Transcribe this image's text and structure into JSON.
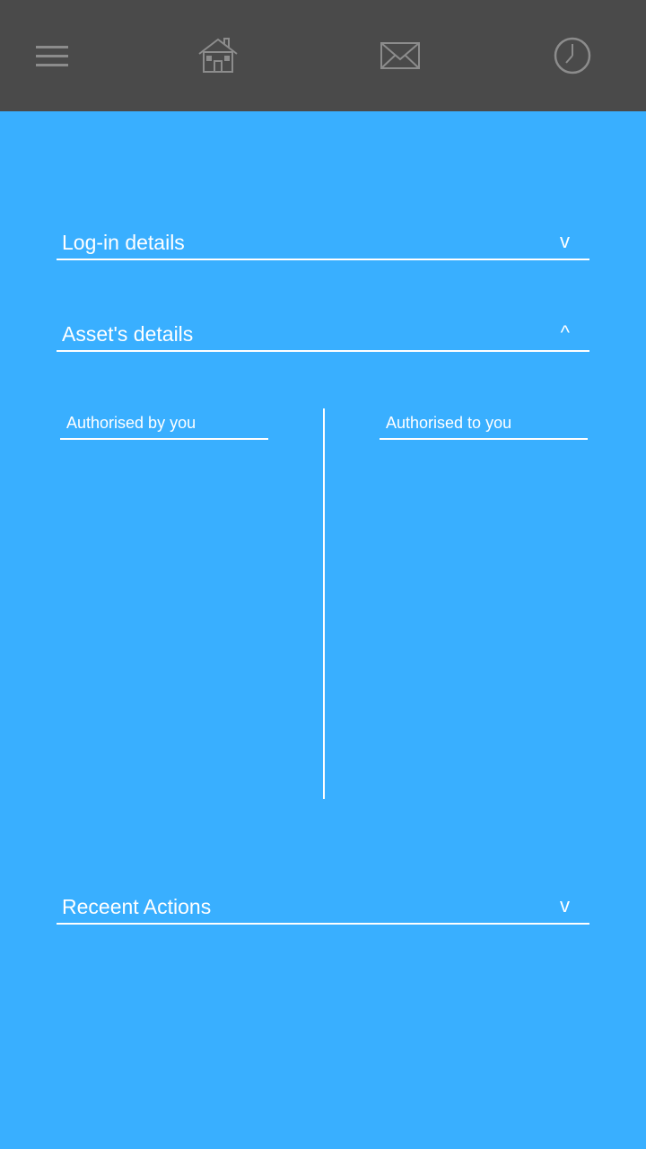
{
  "header": {
    "icons": {
      "menu": "menu-icon",
      "home": "home-icon",
      "mail": "mail-icon",
      "clock": "clock-icon"
    },
    "background": "#4a4a4a",
    "icon_color": "#8c8c8c"
  },
  "theme": {
    "background": "#39afff",
    "text": "#ffffff"
  },
  "sections": {
    "login": {
      "title": "Log-in details",
      "chevron": "v"
    },
    "assets": {
      "title": "Asset's details",
      "chevron": "^",
      "tabs": {
        "by_you": "Authorised by you",
        "to_you": "Authorised to you"
      }
    },
    "recent": {
      "title": "Receent Actions",
      "chevron": "v"
    }
  }
}
